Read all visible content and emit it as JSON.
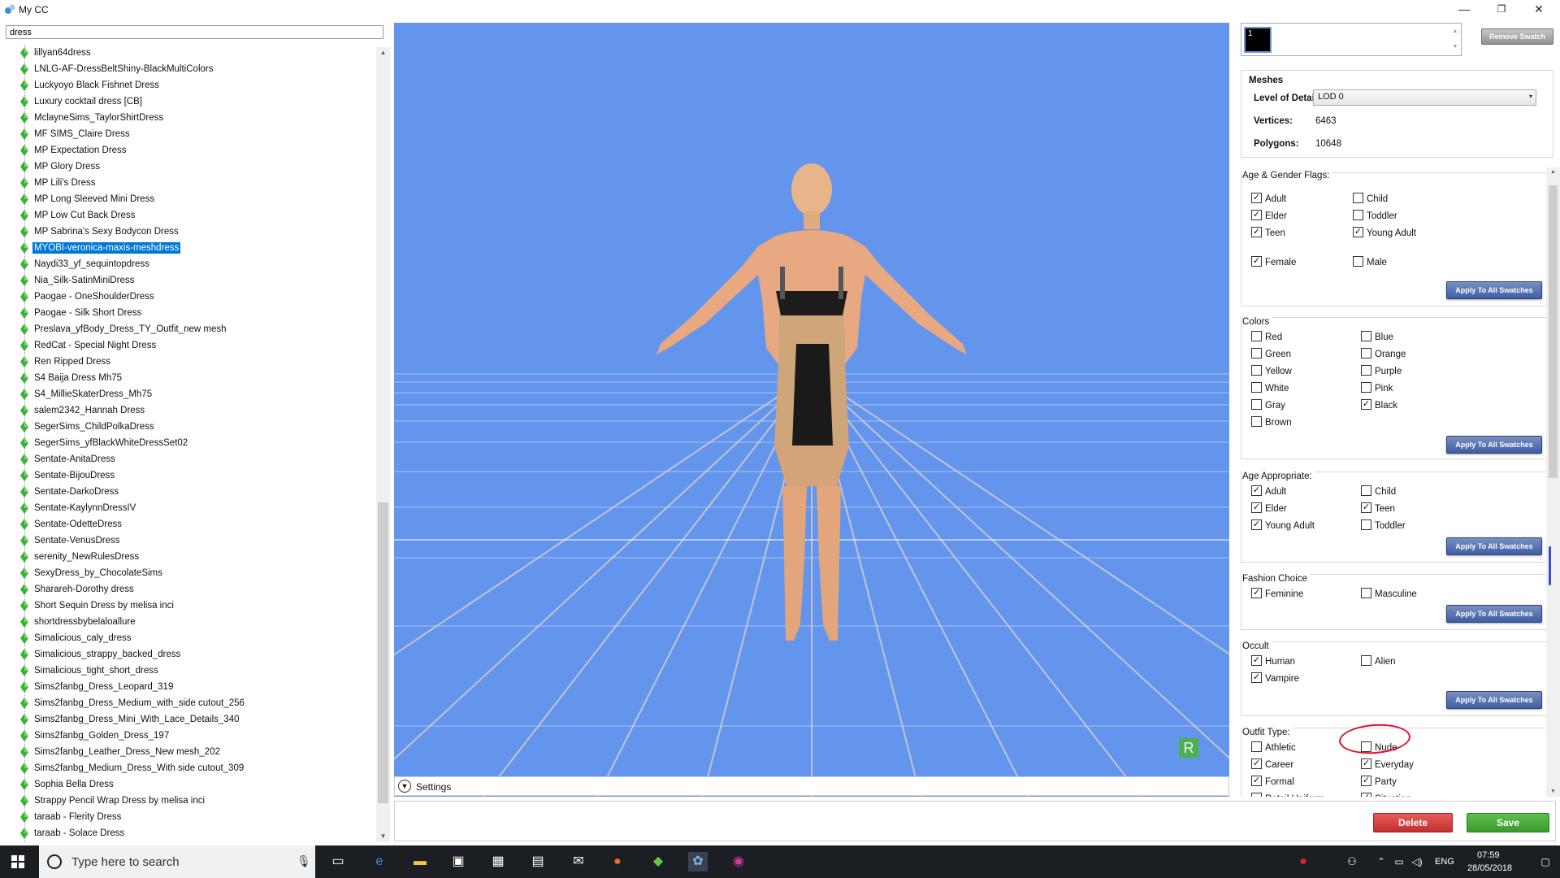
{
  "window": {
    "title": "My CC",
    "min": "—",
    "restore": "❐",
    "close": "✕"
  },
  "search": {
    "value": "dress"
  },
  "tree": {
    "items": [
      "lillyan64dress",
      "LNLG-AF-DressBeltShiny-BlackMultiColors",
      "Luckyoyo Black Fishnet Dress",
      "Luxury cocktail dress [CB]",
      "MclayneSims_TaylorShirtDress",
      "MF SIMS_Claire Dress",
      "MP Expectation Dress",
      "MP Glory Dress",
      "MP Lili's Dress",
      "MP Long Sleeved Mini Dress",
      "MP Low Cut Back Dress",
      "MP Sabrina's Sexy Bodycon Dress",
      "MYOBI-veronica-maxis-meshdress",
      "Naydi33_yf_sequintopdress",
      "Nia_Silk-SatinMiniDress",
      "Paogae - OneShoulderDress",
      "Paogae - Silk Short Dress",
      "Preslava_yfBody_Dress_TY_Outfit_new mesh",
      "RedCat - Special Night Dress",
      "Ren Ripped Dress",
      "S4 Baija Dress Mh75",
      "S4_MillieSkaterDress_Mh75",
      "salem2342_Hannah Dress",
      "SegerSims_ChildPolkaDress",
      "SegerSims_yfBlackWhiteDressSet02",
      "Sentate-AnitaDress",
      "Sentate-BijouDress",
      "Sentate-DarkoDress",
      "Sentate-KaylynnDressIV",
      "Sentate-OdetteDress",
      "Sentate-VenusDress",
      "serenity_NewRulesDress",
      "SexyDress_by_ChocolateSims",
      "Sharareh-Dorothy dress",
      "Short Sequin Dress by melisa inci",
      "shortdressbybelaloallure",
      "Simalicious_caly_dress",
      "Simalicious_strappy_backed_dress",
      "Simalicious_tight_short_dress",
      "Sims2fanbg_Dress_Leopard_319",
      "Sims2fanbg_Dress_Medium_with_side cutout_256",
      "Sims2fanbg_Dress_Mini_With_Lace_Details_340",
      "Sims2fanbg_Golden_Dress_197",
      "Sims2fanbg_Leather_Dress_New mesh_202",
      "Sims2fanbg_Medium_Dress_With side cutout_309",
      "Sophia Bella Dress",
      "Strappy Pencil Wrap Dress by melisa inci",
      "taraab - Flerity Dress",
      "taraab - Solace Dress"
    ],
    "selected_index": 12
  },
  "viewport": {
    "settings_label": "Settings",
    "badge": "R"
  },
  "swatch": {
    "index": "1",
    "remove_label": "Remove Swatch"
  },
  "meshes": {
    "title": "Meshes",
    "lod_label": "Level of Detail",
    "lod_value": "LOD 0",
    "vertices_label": "Vertices:",
    "vertices_value": "6463",
    "polygons_label": "Polygons:",
    "polygons_value": "10648"
  },
  "apply_label": "Apply To All Swatches",
  "age_gender": {
    "title": "Age & Gender Flags:",
    "items": [
      {
        "label": "Adult",
        "checked": true
      },
      {
        "label": "Child",
        "checked": false
      },
      {
        "label": "Elder",
        "checked": true
      },
      {
        "label": "Toddler",
        "checked": false
      },
      {
        "label": "Teen",
        "checked": true
      },
      {
        "label": "Young Adult",
        "checked": true
      },
      {
        "label": "Female",
        "checked": true
      },
      {
        "label": "Male",
        "checked": false
      }
    ]
  },
  "colors": {
    "title": "Colors",
    "items": [
      {
        "label": "Red",
        "checked": false
      },
      {
        "label": "Blue",
        "checked": false
      },
      {
        "label": "Green",
        "checked": false
      },
      {
        "label": "Orange",
        "checked": false
      },
      {
        "label": "Yellow",
        "checked": false
      },
      {
        "label": "Purple",
        "checked": false
      },
      {
        "label": "White",
        "checked": false
      },
      {
        "label": "Pink",
        "checked": false
      },
      {
        "label": "Gray",
        "checked": false
      },
      {
        "label": "Black",
        "checked": true
      },
      {
        "label": "Brown",
        "checked": false
      }
    ]
  },
  "age_appropriate": {
    "title": "Age Appropriate:",
    "items": [
      {
        "label": "Adult",
        "checked": true
      },
      {
        "label": "Child",
        "checked": false
      },
      {
        "label": "Elder",
        "checked": true
      },
      {
        "label": "Teen",
        "checked": true
      },
      {
        "label": "Young Adult",
        "checked": true
      },
      {
        "label": "Toddler",
        "checked": false
      }
    ]
  },
  "fashion": {
    "title": "Fashion Choice",
    "items": [
      {
        "label": "Feminine",
        "checked": true
      },
      {
        "label": "Masculine",
        "checked": false
      }
    ]
  },
  "occult": {
    "title": "Occult",
    "items": [
      {
        "label": "Human",
        "checked": true
      },
      {
        "label": "Alien",
        "checked": false
      },
      {
        "label": "Vampire",
        "checked": true
      }
    ]
  },
  "outfit": {
    "title": "Outfit Type:",
    "items": [
      {
        "label": "Athletic",
        "checked": false
      },
      {
        "label": "Nude",
        "checked": false
      },
      {
        "label": "Career",
        "checked": true
      },
      {
        "label": "Everyday",
        "checked": true
      },
      {
        "label": "Formal",
        "checked": true
      },
      {
        "label": "Party",
        "checked": true
      },
      {
        "label": "Retail Uniform",
        "checked": false
      },
      {
        "label": "Situation",
        "checked": true
      }
    ]
  },
  "actions": {
    "delete_label": "Delete",
    "save_label": "Save"
  },
  "taskbar": {
    "search_placeholder": "Type here to search",
    "lang": "ENG",
    "time": "07:59",
    "date": "28/05/2018"
  },
  "colors_theme": {
    "viewport_bg": "#6495ed",
    "selection": "#0078d7",
    "annotation": "#e0102a"
  }
}
